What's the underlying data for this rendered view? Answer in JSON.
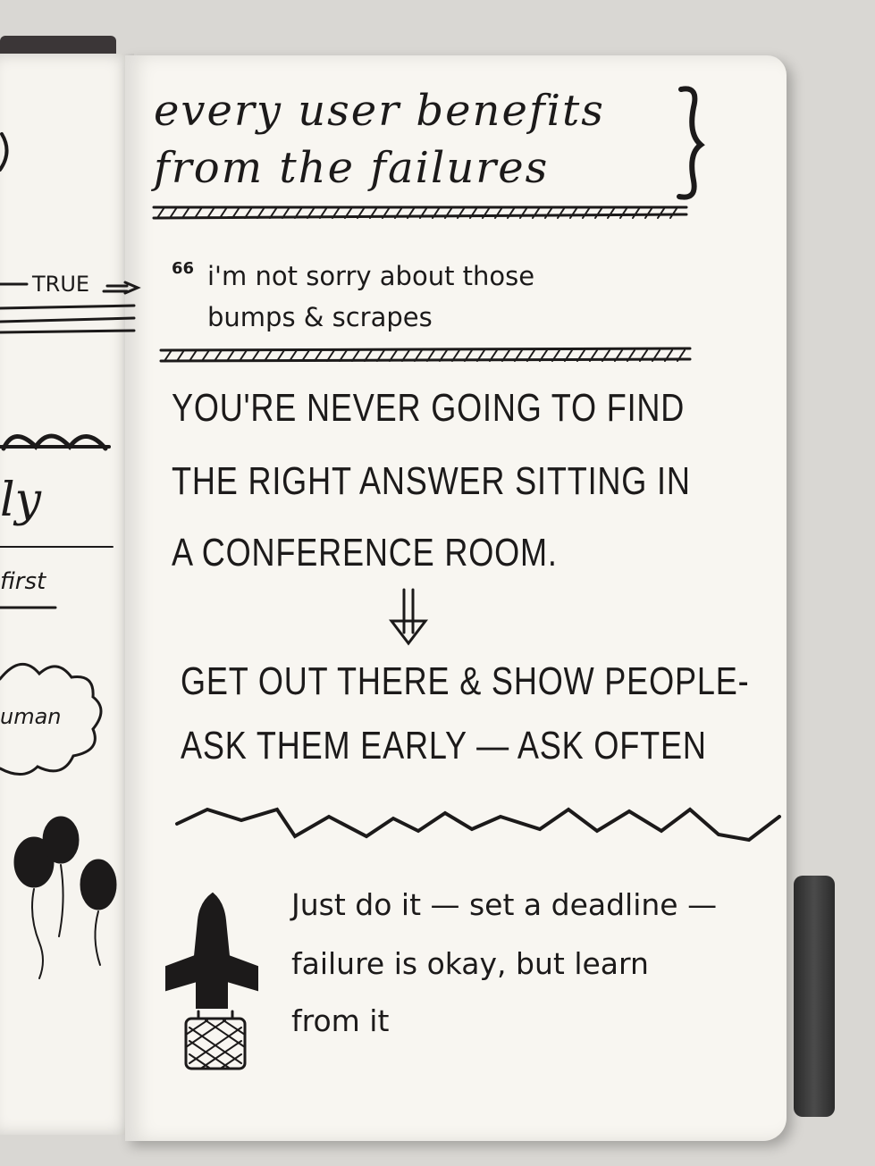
{
  "notebook": {
    "title_lines": [
      "every user benefits",
      "from the failures"
    ],
    "quote_mark": "66",
    "quote_lines": [
      "i'm not sorry about those",
      "bumps & scrapes"
    ],
    "caps_lines": [
      "YOU'RE NEVER GOING TO FIND",
      "THE RIGHT ANSWER SITTING IN",
      "A CONFERENCE ROOM."
    ],
    "action_lines": [
      "GET OUT THERE & SHOW PEOPLE-",
      "ASK THEM EARLY — ASK OFTEN"
    ],
    "closing_lines": [
      "Just do it — set a deadline —",
      "failure is okay, but learn",
      "from it"
    ]
  },
  "left_page": {
    "true_label": "TRUE",
    "script_fragment": "ly",
    "first_fragment": "first",
    "cloud_fragment": "uman"
  },
  "colors": {
    "ink": "#1c1a1a",
    "paper": "#f8f6f1",
    "background": "#d9d7d3"
  }
}
